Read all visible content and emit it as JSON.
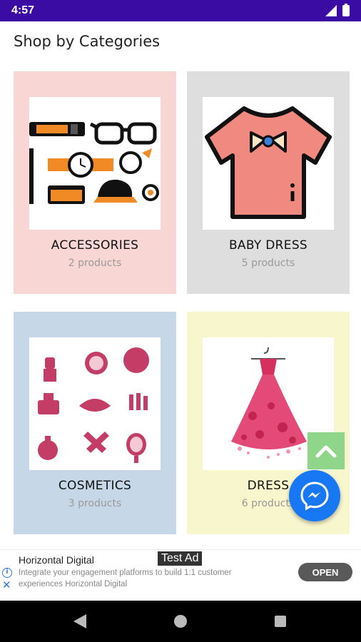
{
  "status_bar": {
    "time": "4:57"
  },
  "page": {
    "title": "Shop by Categories"
  },
  "categories": [
    {
      "name": "ACCESSORIES",
      "count": "2 products",
      "image_icon": "accessories-icon"
    },
    {
      "name": "BABY DRESS",
      "count": "5 products",
      "image_icon": "baby-dress-icon"
    },
    {
      "name": "COSMETICS",
      "count": "3 products",
      "image_icon": "cosmetics-icon"
    },
    {
      "name": "DRESS",
      "count": "6 products",
      "image_icon": "dress-icon"
    }
  ],
  "colors": {
    "status_bar": "#3a0ca3",
    "card_accessories": "#f7d6d3",
    "card_baby_dress": "#dedede",
    "card_cosmetics": "#c6d7e8",
    "card_dress": "#f8f6cd",
    "scroll_top": "#8fd68b",
    "messenger": "#1877f2"
  },
  "ad": {
    "title": "Horizontal Digital",
    "label": "Test Ad",
    "description": "Integrate your engagement platforms to build 1:1 customer experiences Horizontal Digital",
    "cta": "OPEN"
  },
  "icons": {
    "scroll_top": "chevron-up-icon",
    "fab": "messenger-icon",
    "ad_info": "info-icon",
    "ad_close": "close-icon"
  }
}
